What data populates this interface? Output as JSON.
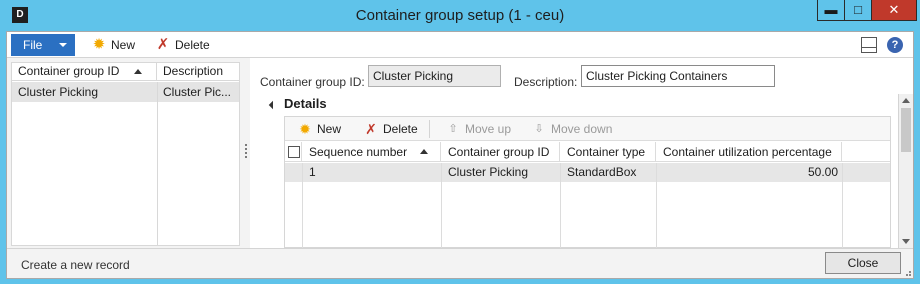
{
  "window": {
    "title": "Container group setup (1 - ceu)",
    "min_glyph": "▬",
    "max_glyph": "□",
    "close_glyph": "✕",
    "app_icon": "dynamics-app-icon"
  },
  "actionpane": {
    "file_label": "File",
    "new_label": "New",
    "delete_label": "Delete"
  },
  "list": {
    "columns": [
      "Container group ID",
      "Description"
    ],
    "rows": [
      {
        "id": "Cluster Picking",
        "description": "Cluster Pic..."
      }
    ]
  },
  "header": {
    "id_label": "Container group ID:",
    "id_value": "Cluster Picking",
    "desc_label": "Description:",
    "desc_value": "Cluster Picking Containers"
  },
  "details": {
    "title": "Details",
    "toolbar": {
      "new_label": "New",
      "delete_label": "Delete",
      "move_up_label": "Move up",
      "move_down_label": "Move down"
    },
    "columns": [
      "Sequence number",
      "Container group ID",
      "Container type",
      "Container utilization percentage"
    ],
    "rows": [
      {
        "sequence": "1",
        "group_id": "Cluster Picking",
        "type": "StandardBox",
        "utilization": "50.00"
      }
    ]
  },
  "status": {
    "text": "Create a new record",
    "close_label": "Close"
  },
  "colors": {
    "titlebar": "#5fc3ea",
    "file_button": "#2b70c2",
    "close_button": "#c0392b"
  }
}
